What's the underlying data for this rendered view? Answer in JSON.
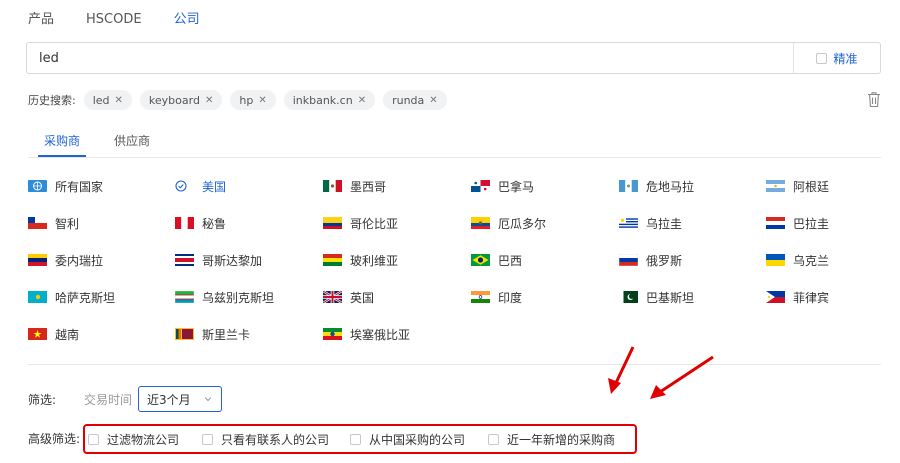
{
  "top_tabs": [
    {
      "label": "产品",
      "active": false
    },
    {
      "label": "HSCODE",
      "active": false
    },
    {
      "label": "公司",
      "active": true
    }
  ],
  "search": {
    "value": "led",
    "exact_label": "精准",
    "exact_checked": false
  },
  "history": {
    "label": "历史搜索:",
    "chips": [
      "led",
      "keyboard",
      "hp",
      "inkbank.cn",
      "runda"
    ],
    "chip_close": "✕"
  },
  "sub_tabs": [
    {
      "label": "采购商",
      "active": true
    },
    {
      "label": "供应商",
      "active": false
    }
  ],
  "countries": [
    {
      "label": "所有国家",
      "flag": "globe",
      "selected": false
    },
    {
      "label": "美国",
      "flag": "check",
      "selected": true
    },
    {
      "label": "墨西哥",
      "flag": "mexico",
      "selected": false
    },
    {
      "label": "巴拿马",
      "flag": "panama",
      "selected": false
    },
    {
      "label": "危地马拉",
      "flag": "guatemala",
      "selected": false
    },
    {
      "label": "阿根廷",
      "flag": "argentina",
      "selected": false
    },
    {
      "label": "智利",
      "flag": "chile",
      "selected": false
    },
    {
      "label": "秘鲁",
      "flag": "peru",
      "selected": false
    },
    {
      "label": "哥伦比亚",
      "flag": "colombia",
      "selected": false
    },
    {
      "label": "厄瓜多尔",
      "flag": "ecuador",
      "selected": false
    },
    {
      "label": "乌拉圭",
      "flag": "uruguay",
      "selected": false
    },
    {
      "label": "巴拉圭",
      "flag": "paraguay",
      "selected": false
    },
    {
      "label": "委内瑞拉",
      "flag": "venezuela",
      "selected": false
    },
    {
      "label": "哥斯达黎加",
      "flag": "costarica",
      "selected": false
    },
    {
      "label": "玻利维亚",
      "flag": "bolivia",
      "selected": false
    },
    {
      "label": "巴西",
      "flag": "brazil",
      "selected": false
    },
    {
      "label": "俄罗斯",
      "flag": "russia",
      "selected": false
    },
    {
      "label": "乌克兰",
      "flag": "ukraine",
      "selected": false
    },
    {
      "label": "哈萨克斯坦",
      "flag": "kazakhstan",
      "selected": false
    },
    {
      "label": "乌兹别克斯坦",
      "flag": "uzbekistan",
      "selected": false
    },
    {
      "label": "英国",
      "flag": "uk",
      "selected": false
    },
    {
      "label": "印度",
      "flag": "india",
      "selected": false
    },
    {
      "label": "巴基斯坦",
      "flag": "pakistan",
      "selected": false
    },
    {
      "label": "菲律宾",
      "flag": "philippines",
      "selected": false
    },
    {
      "label": "越南",
      "flag": "vietnam",
      "selected": false
    },
    {
      "label": "斯里兰卡",
      "flag": "srilanka",
      "selected": false
    },
    {
      "label": "埃塞俄比亚",
      "flag": "ethiopia",
      "selected": false
    }
  ],
  "filter": {
    "label": "筛选:",
    "trade_time_label": "交易时间",
    "trade_time_value": "近3个月"
  },
  "advanced": {
    "label": "高级筛选:",
    "options": [
      "过滤物流公司",
      "只看有联系人的公司",
      "从中国采购的公司",
      "近一年新增的采购商"
    ]
  },
  "colors": {
    "accent": "#1f63d6",
    "annotation": "#e10000",
    "divider": "#e8e8e8"
  }
}
